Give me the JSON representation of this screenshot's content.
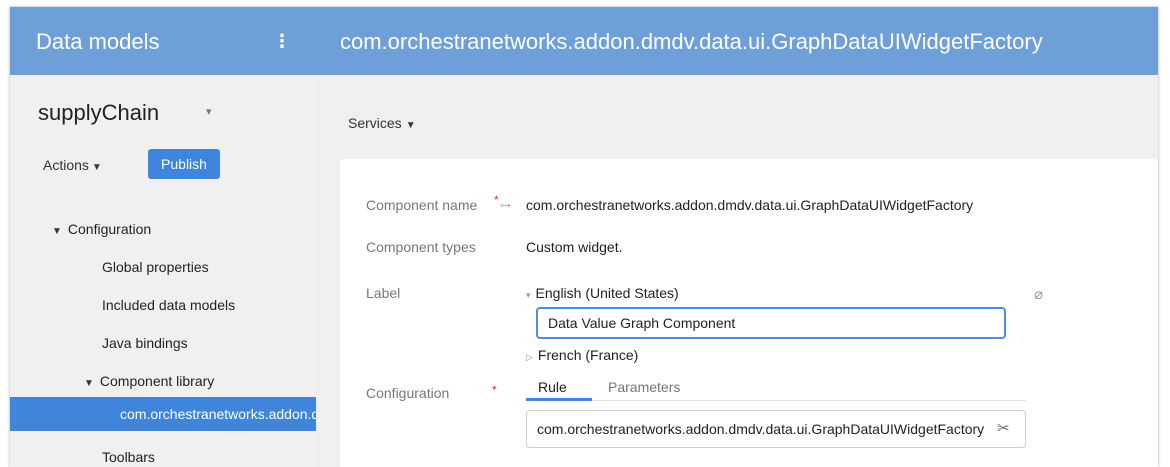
{
  "header": {
    "title": "Data models",
    "menu_icon": "⋮",
    "component_path": "com.orchestranetworks.addon.dmdv.data.ui.GraphDataUIWidgetFactory"
  },
  "sidebar": {
    "model_name": "supplyChain",
    "model_caret": "▾",
    "actions_label": "Actions",
    "publish_label": "Publish",
    "tree": {
      "configuration": "Configuration",
      "global_properties": "Global properties",
      "included_data_models": "Included data models",
      "java_bindings": "Java bindings",
      "component_library": "Component library",
      "selected_item": "com.orchestranetworks.addon.dmdv.data.ui.GraphDataUIWidgetFactory",
      "toolbars": "Toolbars"
    }
  },
  "main": {
    "services_label": "Services",
    "form": {
      "component_name_label": "Component name",
      "component_name_value": "com.orchestranetworks.addon.dmdv.data.ui.GraphDataUIWidgetFactory",
      "component_types_label": "Component types",
      "component_types_value": "Custom widget.",
      "label_label": "Label",
      "lang_english": "English (United States)",
      "label_value": "Data Value Graph Component",
      "lang_french": "French (France)",
      "configuration_label": "Configuration",
      "tab_rule": "Rule",
      "tab_parameters": "Parameters",
      "configuration_value": "com.orchestranetworks.addon.dmdv.data.ui.GraphDataUIWidgetFactory",
      "required_mark": "*"
    }
  },
  "icons": {
    "caret": "▾",
    "tri_down": "▼",
    "tri_collapsed": "▷",
    "clear": "⌀",
    "wizard": "✂"
  },
  "colors": {
    "header_bg": "#6e9fd8",
    "accent": "#3f85dc",
    "required": "#d43535"
  }
}
